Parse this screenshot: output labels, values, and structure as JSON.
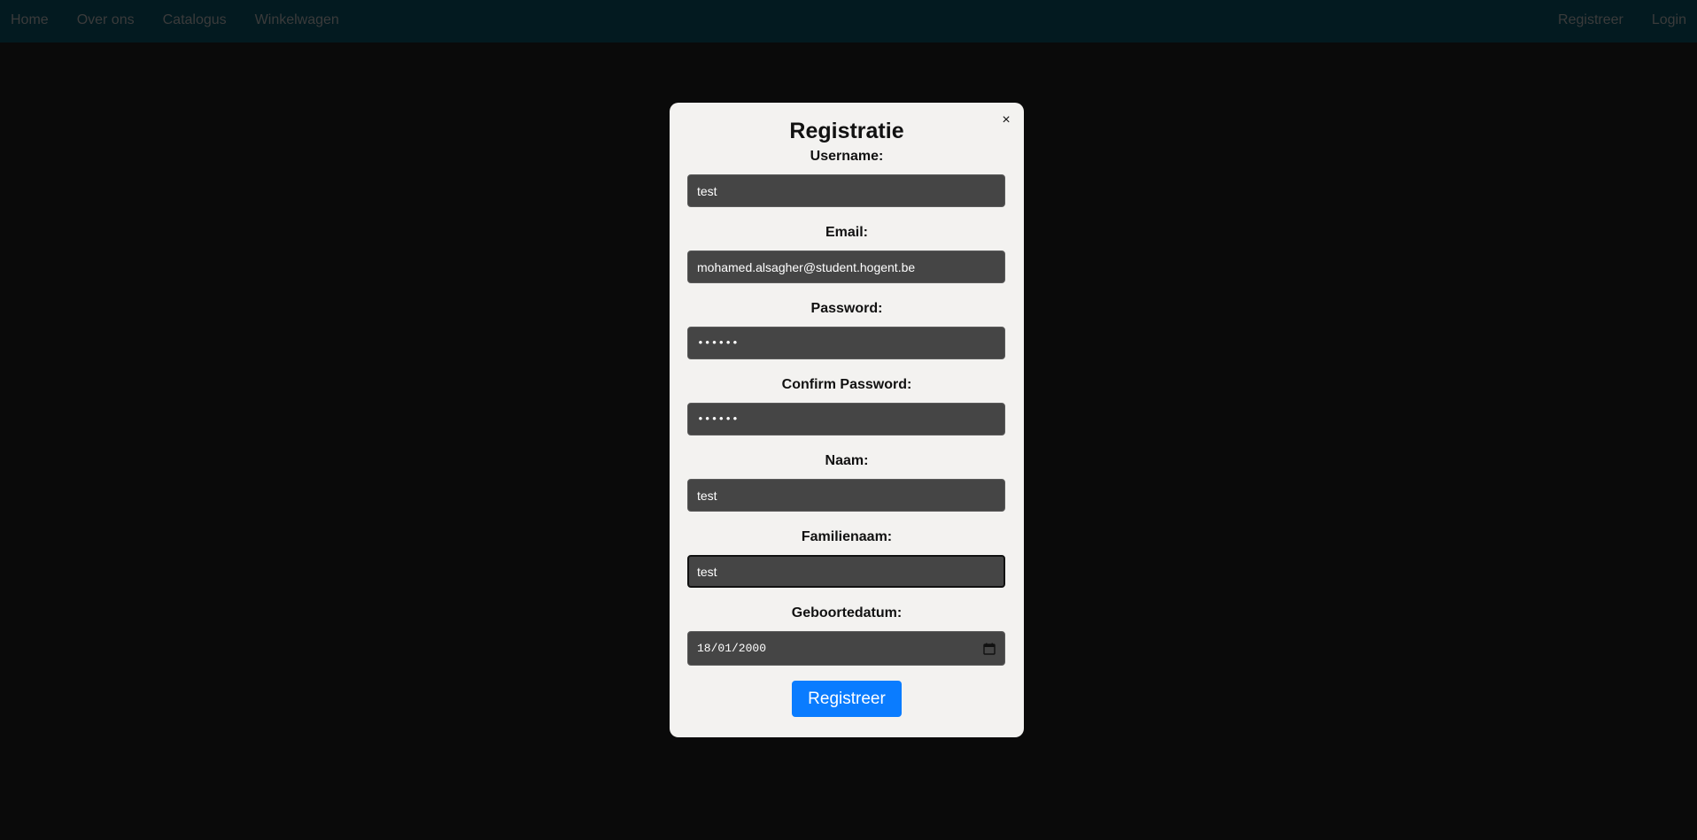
{
  "nav": {
    "left_links": [
      "Home",
      "Over ons",
      "Catalogus",
      "Winkelwagen"
    ],
    "right_links": [
      "Registreer",
      "Login"
    ]
  },
  "modal": {
    "title": "Registratie",
    "close_glyph": "×",
    "fields": {
      "username": {
        "label": "Username:",
        "value": "test"
      },
      "email": {
        "label": "Email:",
        "value": "mohamed.alsagher@student.hogent.be"
      },
      "password": {
        "label": "Password:",
        "value": "••••••"
      },
      "confirm_password": {
        "label": "Confirm Password:",
        "value": "••••••"
      },
      "naam": {
        "label": "Naam:",
        "value": "test"
      },
      "familienaam": {
        "label": "Familienaam:",
        "value": "test"
      },
      "geboortedatum": {
        "label": "Geboortedatum:",
        "value": "18/01/2000"
      }
    },
    "submit_label": "Registreer"
  },
  "colors": {
    "page_background": "#0a0a0a",
    "navbar_background": "#031a20",
    "modal_background": "#f3f2f0",
    "input_background": "#454545",
    "button_primary": "#0a7cff"
  }
}
